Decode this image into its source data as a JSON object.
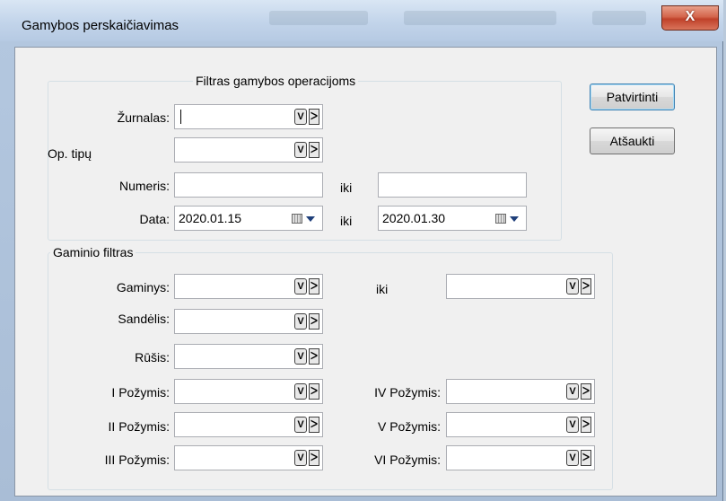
{
  "window": {
    "title": "Gamybos perskaičiavimas",
    "close_glyph": "X"
  },
  "buttons": {
    "confirm_label": "Patvirtinti",
    "cancel_label": "Atšaukti"
  },
  "operations_filter": {
    "title": "Filtras gamybos operacijoms",
    "journal_label": "Žurnalas:",
    "journal_value": "",
    "op_type_label": "Op. tipų",
    "op_type_value": "",
    "number_label": "Numeris:",
    "number_from": "",
    "number_to_label": "iki",
    "number_to": "",
    "date_label": "Data:",
    "date_from": "2020.01.15",
    "date_to_label": "iki",
    "date_to": "2020.01.30"
  },
  "product_filter": {
    "title": "Gaminio filtras",
    "product_label": "Gaminys:",
    "product_from": "",
    "product_to_label": "iki",
    "product_to": "",
    "warehouse_label": "Sandėlis:",
    "warehouse_value": "",
    "type_label": "Rūšis:",
    "type_value": "",
    "attr1_label": "I Požymis:",
    "attr2_label": "II Požymis:",
    "attr3_label": "III Požymis:",
    "attr4_label": "IV Požymis:",
    "attr5_label": "V Požymis:",
    "attr6_label": "VI Požymis:"
  },
  "icons": {
    "combo_dropdown": "filter-dropdown-icon",
    "combo_next": "next-arrow-icon",
    "combo_dropdown_glyph": "V",
    "combo_next_glyph": "ᐳ",
    "calendar": "calendar-icon"
  }
}
